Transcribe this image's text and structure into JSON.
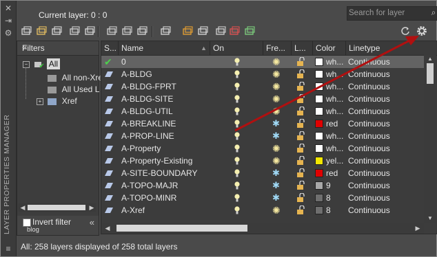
{
  "sidebar": {
    "title": "LAYER PROPERTIES MANAGER"
  },
  "header": {
    "current_layer_label": "Current layer: 0 : 0"
  },
  "search": {
    "placeholder": "Search for layer"
  },
  "filters": {
    "title": "Filters",
    "tree": [
      {
        "label": "All",
        "level": 0
      },
      {
        "label": "All non-Xref",
        "level": 1
      },
      {
        "label": "All Used L",
        "level": 1
      },
      {
        "label": "Xref",
        "level": 0
      }
    ],
    "invert_label": "Invert filter",
    "hover_note": "blog"
  },
  "columns": [
    "S...",
    "Name",
    "On",
    "Fre...",
    "L...",
    "Color",
    "Linetype"
  ],
  "layers": [
    {
      "name": "0",
      "color": "wh...",
      "color_hex": "#ffffff",
      "linetype": "Continuous",
      "current": true,
      "frozen": false
    },
    {
      "name": "A-BLDG",
      "color": "wh...",
      "color_hex": "#ffffff",
      "linetype": "Continuous",
      "current": false,
      "frozen": false
    },
    {
      "name": "A-BLDG-FPRT",
      "color": "wh...",
      "color_hex": "#ffffff",
      "linetype": "Continuous",
      "current": false,
      "frozen": false
    },
    {
      "name": "A-BLDG-SITE",
      "color": "wh...",
      "color_hex": "#ffffff",
      "linetype": "Continuous",
      "current": false,
      "frozen": false
    },
    {
      "name": "A-BLDG-UTIL",
      "color": "wh...",
      "color_hex": "#ffffff",
      "linetype": "Continuous",
      "current": false,
      "frozen": false
    },
    {
      "name": "A-BREAKLINE",
      "color": "red",
      "color_hex": "#e00000",
      "linetype": "Continuous",
      "current": false,
      "frozen": true
    },
    {
      "name": "A-PROP-LINE",
      "color": "wh...",
      "color_hex": "#ffffff",
      "linetype": "Continuous",
      "current": false,
      "frozen": true
    },
    {
      "name": "A-Property",
      "color": "wh...",
      "color_hex": "#ffffff",
      "linetype": "Continuous",
      "current": false,
      "frozen": false
    },
    {
      "name": "A-Property-Existing",
      "color": "yel...",
      "color_hex": "#f2e600",
      "linetype": "Continuous",
      "current": false,
      "frozen": false
    },
    {
      "name": "A-SITE-BOUNDARY",
      "color": "red",
      "color_hex": "#e00000",
      "linetype": "Continuous",
      "current": false,
      "frozen": true
    },
    {
      "name": "A-TOPO-MAJR",
      "color": "9",
      "color_hex": "#a8a8a8",
      "linetype": "Continuous",
      "current": false,
      "frozen": true
    },
    {
      "name": "A-TOPO-MINR",
      "color": "8",
      "color_hex": "#6e6e6e",
      "linetype": "Continuous",
      "current": false,
      "frozen": true
    },
    {
      "name": "A-Xref",
      "color": "8",
      "color_hex": "#6e6e6e",
      "linetype": "Continuous",
      "current": false,
      "frozen": false
    }
  ],
  "status": {
    "text": "All: 258 layers displayed of 258 total layers"
  },
  "colors": {
    "annotation_arrow": "#b01010",
    "selected_row": "#636363"
  },
  "icons": {
    "toolbar": [
      "new-property-filter-icon",
      "new-group-filter-icon",
      "layer-states-manager-icon",
      "layer-states-icon",
      "save-icon",
      "new-layer-icon",
      "new-layer-vp-frozen-icon",
      "delete-layer-icon",
      "set-current-icon",
      "isolate-icon",
      "match-icon",
      "merge-icon",
      "walk-icon",
      "freeze-icon"
    ],
    "top_right": [
      "refresh-icon",
      "settings-gear-icon"
    ]
  }
}
